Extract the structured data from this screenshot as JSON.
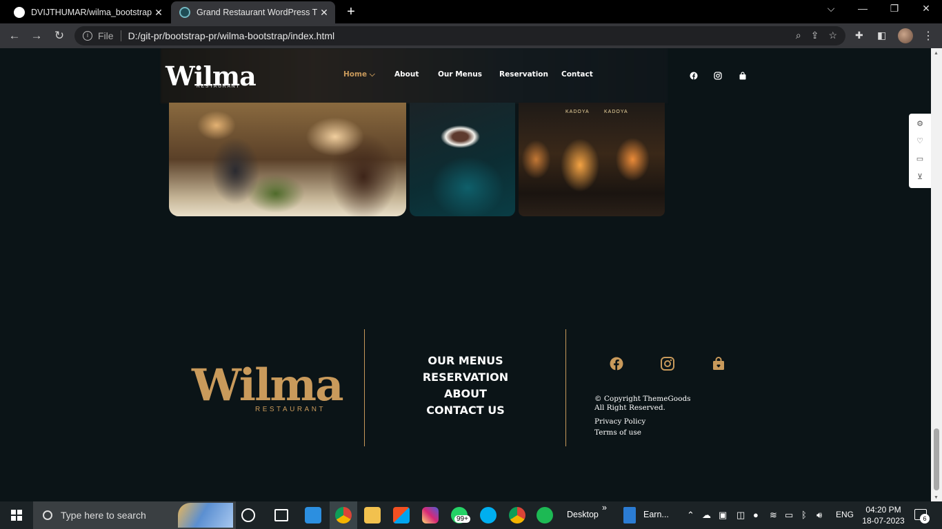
{
  "browser": {
    "tabs": [
      {
        "title": "DVIJTHUMAR/wilma_bootstrap"
      },
      {
        "title": "Grand Restaurant WordPress The"
      }
    ],
    "new_tab": "+",
    "win_minimize": "⌵",
    "win_min2": "—",
    "win_restore": "❐",
    "win_close": "✕",
    "tab_close": "✕",
    "address": {
      "scheme_label": "File",
      "url": "D:/git-pr/bootstrap-pr/wilma-bootstrap/index.html"
    }
  },
  "site": {
    "logo": "Wilma",
    "logo_sub": "RESTAURANT",
    "nav": {
      "home": "Home ⌵",
      "about": "About",
      "menus": "Our Menus",
      "reservation": "Reservation",
      "contact": "Contact"
    },
    "photo_sign": "KADOYA"
  },
  "footer": {
    "logo": "Wilma",
    "logo_sub": "RESTAURANT",
    "menu": [
      "OUR MENUS",
      "RESERVATION",
      "ABOUT",
      "CONTACT US"
    ],
    "copyright_line1": "© Copyright ThemeGoods",
    "copyright_line2": "All Right Reserved.",
    "privacy": "Privacy Policy",
    "terms": "Terms of use"
  },
  "taskbar": {
    "search_placeholder": "Type here to search",
    "whatsapp_badge": "99+",
    "desktop_label": "Desktop",
    "chevron": "»",
    "app_label": "Earn...",
    "language": "ENG",
    "time": "04:20 PM",
    "date": "18-07-2023",
    "notif_count": "6"
  },
  "colors": {
    "accent": "#c99a5b",
    "page_bg": "#0b1417"
  }
}
